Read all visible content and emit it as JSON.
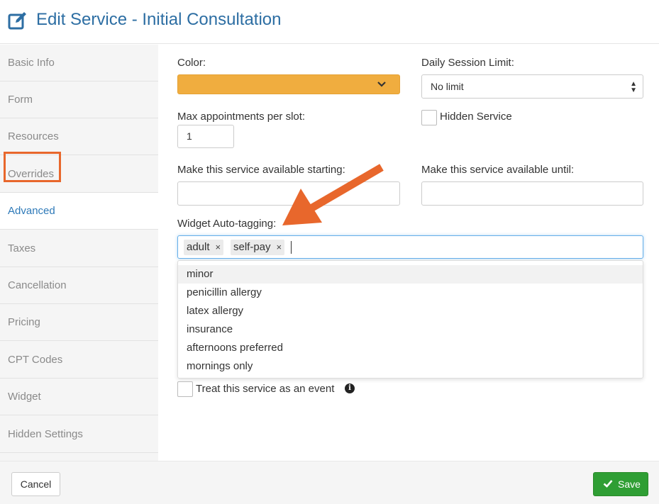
{
  "header": {
    "title": "Edit Service - Initial Consultation"
  },
  "sidebar": {
    "items": [
      {
        "label": "Basic Info"
      },
      {
        "label": "Form"
      },
      {
        "label": "Resources"
      },
      {
        "label": "Overrides"
      },
      {
        "label": "Advanced",
        "active": true
      },
      {
        "label": "Taxes"
      },
      {
        "label": "Cancellation"
      },
      {
        "label": "Pricing"
      },
      {
        "label": "CPT Codes"
      },
      {
        "label": "Widget"
      },
      {
        "label": "Hidden Settings"
      }
    ]
  },
  "form": {
    "color_label": "Color:",
    "color_value": "#f0ad3f",
    "daily_limit_label": "Daily Session Limit:",
    "daily_limit_value": "No limit",
    "max_appts_label": "Max appointments per slot:",
    "max_appts_value": "1",
    "hidden_service_label": "Hidden Service",
    "available_starting_label": "Make this service available starting:",
    "available_until_label": "Make this service available until:",
    "autotag_label": "Widget Auto-tagging:",
    "tags": [
      "adult",
      "self-pay"
    ],
    "tag_remove_glyph": "×",
    "dropdown_options": [
      "minor",
      "penicillin allergy",
      "latex allergy",
      "insurance",
      "afternoons preferred",
      "mornings only"
    ],
    "event_label": "Treat this service as an event",
    "info_glyph": "i"
  },
  "footer": {
    "cancel_label": "Cancel",
    "save_label": "Save"
  },
  "colors": {
    "brand_blue": "#2d6ea3",
    "highlight_orange": "#e8672c",
    "save_green": "#2f9e34"
  }
}
